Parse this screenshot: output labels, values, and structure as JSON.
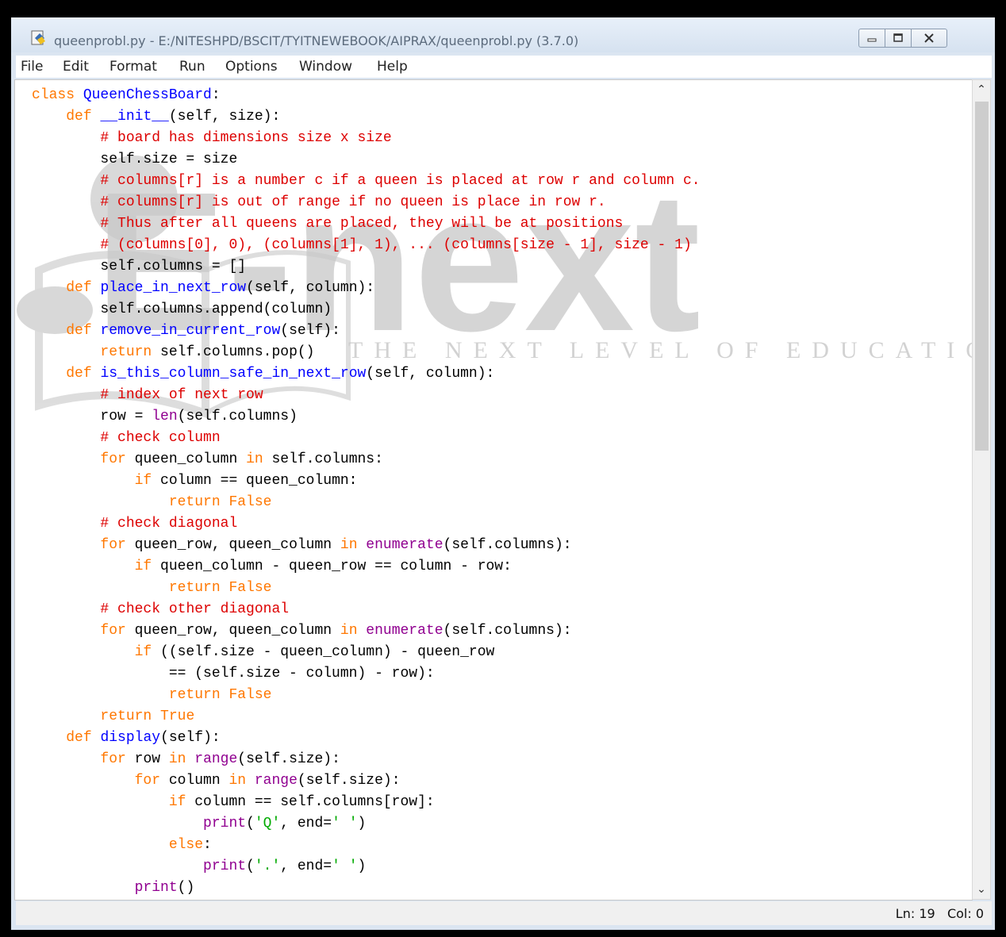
{
  "window": {
    "title": "queenprobl.py - E:/NITESHPD/BSCIT/TYITNEWEBOOK/AIPRAX/queenprobl.py (3.7.0)"
  },
  "menu": [
    "File",
    "Edit",
    "Format",
    "Run",
    "Options",
    "Window",
    "Help"
  ],
  "watermark": {
    "brand": "E-next",
    "tagline": "THE NEXT LEVEL OF EDUCATION"
  },
  "code_lines": [
    [
      [
        "kw",
        "class "
      ],
      [
        "def",
        "QueenChessBoard"
      ],
      [
        "",
        ":"
      ]
    ],
    [
      [
        "",
        "    "
      ],
      [
        "kw",
        "def "
      ],
      [
        "def",
        "__init__"
      ],
      [
        "",
        "(self, size):"
      ]
    ],
    [
      [
        "",
        "        "
      ],
      [
        "cm",
        "# board has dimensions size x size"
      ]
    ],
    [
      [
        "",
        "        self.size = size"
      ]
    ],
    [
      [
        "",
        "        "
      ],
      [
        "cm",
        "# columns[r] is a number c if a queen is placed at row r and column c."
      ]
    ],
    [
      [
        "",
        "        "
      ],
      [
        "cm",
        "# columns[r] is out of range if no queen is place in row r."
      ]
    ],
    [
      [
        "",
        "        "
      ],
      [
        "cm",
        "# Thus after all queens are placed, they will be at positions"
      ]
    ],
    [
      [
        "",
        "        "
      ],
      [
        "cm",
        "# (columns[0], 0), (columns[1], 1), ... (columns[size - 1], size - 1)"
      ]
    ],
    [
      [
        "",
        "        self.columns = []"
      ]
    ],
    [
      [
        "",
        "    "
      ],
      [
        "kw",
        "def "
      ],
      [
        "def",
        "place_in_next_row"
      ],
      [
        "",
        "(self, column):"
      ]
    ],
    [
      [
        "",
        "        self.columns.append(column)"
      ]
    ],
    [
      [
        "",
        "    "
      ],
      [
        "kw",
        "def "
      ],
      [
        "def",
        "remove_in_current_row"
      ],
      [
        "",
        "(self):"
      ]
    ],
    [
      [
        "",
        "        "
      ],
      [
        "kw",
        "return "
      ],
      [
        "",
        "self.columns.pop()"
      ]
    ],
    [
      [
        "",
        "    "
      ],
      [
        "kw",
        "def "
      ],
      [
        "def",
        "is_this_column_safe_in_next_row"
      ],
      [
        "",
        "(self, column):"
      ]
    ],
    [
      [
        "",
        "        "
      ],
      [
        "cm",
        "# index of next row"
      ]
    ],
    [
      [
        "",
        "        row = "
      ],
      [
        "bi",
        "len"
      ],
      [
        "",
        "(self.columns)"
      ]
    ],
    [
      [
        "",
        "        "
      ],
      [
        "cm",
        "# check column"
      ]
    ],
    [
      [
        "",
        "        "
      ],
      [
        "kw",
        "for "
      ],
      [
        "",
        "queen_column "
      ],
      [
        "kw",
        "in "
      ],
      [
        "",
        "self.columns:"
      ]
    ],
    [
      [
        "",
        "            "
      ],
      [
        "kw",
        "if "
      ],
      [
        "",
        "column == queen_column:"
      ]
    ],
    [
      [
        "",
        "                "
      ],
      [
        "kw",
        "return False"
      ]
    ],
    [
      [
        "",
        "        "
      ],
      [
        "cm",
        "# check diagonal"
      ]
    ],
    [
      [
        "",
        "        "
      ],
      [
        "kw",
        "for "
      ],
      [
        "",
        "queen_row, queen_column "
      ],
      [
        "kw",
        "in "
      ],
      [
        "bi",
        "enumerate"
      ],
      [
        "",
        "(self.columns):"
      ]
    ],
    [
      [
        "",
        "            "
      ],
      [
        "kw",
        "if "
      ],
      [
        "",
        "queen_column - queen_row == column - row:"
      ]
    ],
    [
      [
        "",
        "                "
      ],
      [
        "kw",
        "return False"
      ]
    ],
    [
      [
        "",
        "        "
      ],
      [
        "cm",
        "# check other diagonal"
      ]
    ],
    [
      [
        "",
        "        "
      ],
      [
        "kw",
        "for "
      ],
      [
        "",
        "queen_row, queen_column "
      ],
      [
        "kw",
        "in "
      ],
      [
        "bi",
        "enumerate"
      ],
      [
        "",
        "(self.columns):"
      ]
    ],
    [
      [
        "",
        "            "
      ],
      [
        "kw",
        "if "
      ],
      [
        "",
        "((self.size - queen_column) - queen_row"
      ]
    ],
    [
      [
        "",
        "                == (self.size - column) - row):"
      ]
    ],
    [
      [
        "",
        "                "
      ],
      [
        "kw",
        "return False"
      ]
    ],
    [
      [
        "",
        "        "
      ],
      [
        "kw",
        "return True"
      ]
    ],
    [
      [
        "",
        "    "
      ],
      [
        "kw",
        "def "
      ],
      [
        "def",
        "display"
      ],
      [
        "",
        "(self):"
      ]
    ],
    [
      [
        "",
        "        "
      ],
      [
        "kw",
        "for "
      ],
      [
        "",
        "row "
      ],
      [
        "kw",
        "in "
      ],
      [
        "bi",
        "range"
      ],
      [
        "",
        "(self.size):"
      ]
    ],
    [
      [
        "",
        "            "
      ],
      [
        "kw",
        "for "
      ],
      [
        "",
        "column "
      ],
      [
        "kw",
        "in "
      ],
      [
        "bi",
        "range"
      ],
      [
        "",
        "(self.size):"
      ]
    ],
    [
      [
        "",
        "                "
      ],
      [
        "kw",
        "if "
      ],
      [
        "",
        "column == self.columns[row]:"
      ]
    ],
    [
      [
        "",
        "                    "
      ],
      [
        "bi",
        "print"
      ],
      [
        "",
        "("
      ],
      [
        "st",
        "'Q'"
      ],
      [
        "",
        ", end="
      ],
      [
        "st",
        "' '"
      ],
      [
        "",
        ")"
      ]
    ],
    [
      [
        "",
        "                "
      ],
      [
        "kw",
        "else"
      ],
      [
        "",
        ":"
      ]
    ],
    [
      [
        "",
        "                    "
      ],
      [
        "bi",
        "print"
      ],
      [
        "",
        "("
      ],
      [
        "st",
        "'.'"
      ],
      [
        "",
        ", end="
      ],
      [
        "st",
        "' '"
      ],
      [
        "",
        ")"
      ]
    ],
    [
      [
        "",
        "            "
      ],
      [
        "bi",
        "print"
      ],
      [
        "",
        "()"
      ]
    ]
  ],
  "status": {
    "line": "Ln: 19",
    "col": "Col: 0"
  }
}
